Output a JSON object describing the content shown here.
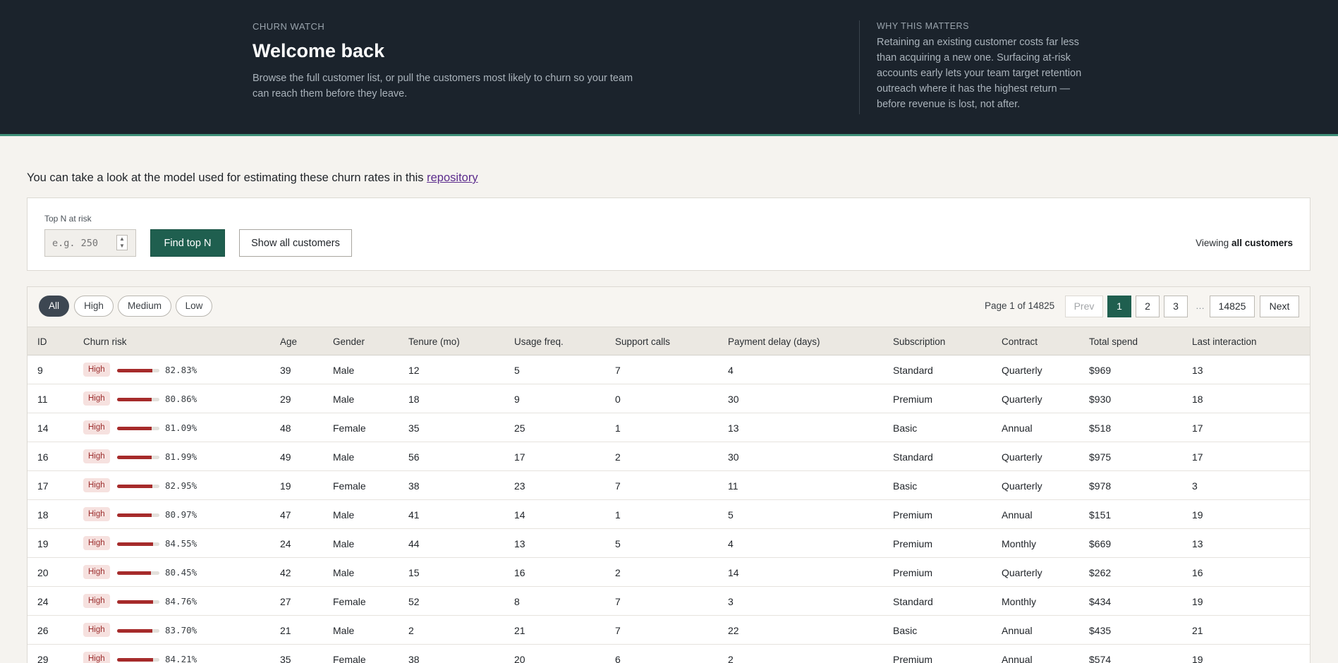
{
  "hero": {
    "eyebrow": "CHURN WATCH",
    "title": "Welcome back",
    "description": "Browse the full customer list, or pull the customers most likely to churn so your team can reach them before they leave.",
    "why_eyebrow": "WHY THIS MATTERS",
    "why_text": "Retaining an existing customer costs far less than acquiring a new one. Surfacing at-risk accounts early lets your team target retention outreach where it has the highest return — before revenue is lost, not after."
  },
  "repo": {
    "prefix": "You can take a look at the model used for estimating these churn rates in this ",
    "link_text": "repository"
  },
  "controls": {
    "label": "Top N at risk",
    "placeholder": "e.g. 250",
    "find_label": "Find top N",
    "show_all_label": "Show all customers",
    "viewing_prefix": "Viewing ",
    "viewing_value": "all customers"
  },
  "filters": [
    "All",
    "High",
    "Medium",
    "Low"
  ],
  "pagination": {
    "info": "Page 1 of 14825",
    "prev": "Prev",
    "pages": [
      "1",
      "2",
      "3"
    ],
    "ellipsis": "…",
    "last": "14825",
    "next": "Next"
  },
  "columns": [
    "ID",
    "Churn risk",
    "Age",
    "Gender",
    "Tenure (mo)",
    "Usage freq.",
    "Support calls",
    "Payment delay (days)",
    "Subscription",
    "Contract",
    "Total spend",
    "Last interaction"
  ],
  "rows": [
    {
      "id": "9",
      "risk": "High",
      "pct": "82.83%",
      "frac": 0.8283,
      "age": "39",
      "gender": "Male",
      "tenure": "12",
      "usage": "5",
      "calls": "7",
      "delay": "4",
      "sub": "Standard",
      "contract": "Quarterly",
      "spend": "$969",
      "last": "13"
    },
    {
      "id": "11",
      "risk": "High",
      "pct": "80.86%",
      "frac": 0.8086,
      "age": "29",
      "gender": "Male",
      "tenure": "18",
      "usage": "9",
      "calls": "0",
      "delay": "30",
      "sub": "Premium",
      "contract": "Quarterly",
      "spend": "$930",
      "last": "18"
    },
    {
      "id": "14",
      "risk": "High",
      "pct": "81.09%",
      "frac": 0.8109,
      "age": "48",
      "gender": "Female",
      "tenure": "35",
      "usage": "25",
      "calls": "1",
      "delay": "13",
      "sub": "Basic",
      "contract": "Annual",
      "spend": "$518",
      "last": "17"
    },
    {
      "id": "16",
      "risk": "High",
      "pct": "81.99%",
      "frac": 0.8199,
      "age": "49",
      "gender": "Male",
      "tenure": "56",
      "usage": "17",
      "calls": "2",
      "delay": "30",
      "sub": "Standard",
      "contract": "Quarterly",
      "spend": "$975",
      "last": "17"
    },
    {
      "id": "17",
      "risk": "High",
      "pct": "82.95%",
      "frac": 0.8295,
      "age": "19",
      "gender": "Female",
      "tenure": "38",
      "usage": "23",
      "calls": "7",
      "delay": "11",
      "sub": "Basic",
      "contract": "Quarterly",
      "spend": "$978",
      "last": "3"
    },
    {
      "id": "18",
      "risk": "High",
      "pct": "80.97%",
      "frac": 0.8097,
      "age": "47",
      "gender": "Male",
      "tenure": "41",
      "usage": "14",
      "calls": "1",
      "delay": "5",
      "sub": "Premium",
      "contract": "Annual",
      "spend": "$151",
      "last": "19"
    },
    {
      "id": "19",
      "risk": "High",
      "pct": "84.55%",
      "frac": 0.8455,
      "age": "24",
      "gender": "Male",
      "tenure": "44",
      "usage": "13",
      "calls": "5",
      "delay": "4",
      "sub": "Premium",
      "contract": "Monthly",
      "spend": "$669",
      "last": "13"
    },
    {
      "id": "20",
      "risk": "High",
      "pct": "80.45%",
      "frac": 0.8045,
      "age": "42",
      "gender": "Male",
      "tenure": "15",
      "usage": "16",
      "calls": "2",
      "delay": "14",
      "sub": "Premium",
      "contract": "Quarterly",
      "spend": "$262",
      "last": "16"
    },
    {
      "id": "24",
      "risk": "High",
      "pct": "84.76%",
      "frac": 0.8476,
      "age": "27",
      "gender": "Female",
      "tenure": "52",
      "usage": "8",
      "calls": "7",
      "delay": "3",
      "sub": "Standard",
      "contract": "Monthly",
      "spend": "$434",
      "last": "19"
    },
    {
      "id": "26",
      "risk": "High",
      "pct": "83.70%",
      "frac": 0.837,
      "age": "21",
      "gender": "Male",
      "tenure": "2",
      "usage": "21",
      "calls": "7",
      "delay": "22",
      "sub": "Basic",
      "contract": "Annual",
      "spend": "$435",
      "last": "21"
    },
    {
      "id": "29",
      "risk": "High",
      "pct": "84.21%",
      "frac": 0.8421,
      "age": "35",
      "gender": "Female",
      "tenure": "38",
      "usage": "20",
      "calls": "6",
      "delay": "2",
      "sub": "Premium",
      "contract": "Annual",
      "spend": "$574",
      "last": "19"
    }
  ]
}
